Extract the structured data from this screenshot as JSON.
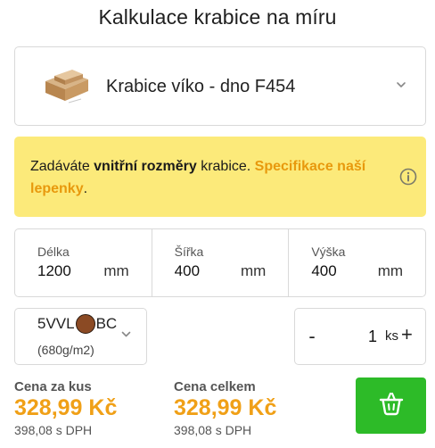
{
  "title": "Kalkulace krabice na míru",
  "product": {
    "name": "Krabice víko - dno F454",
    "thumb_icon": "box-icon"
  },
  "info": {
    "prefix": "Zadáváte ",
    "bold": "vnitřní rozměry",
    "middle": " krabice. ",
    "link": "Specifikace naší lepenky",
    "suffix": ".",
    "icon": "info-icon"
  },
  "dimensions": [
    {
      "label": "Délka",
      "value": "1200",
      "unit": "mm"
    },
    {
      "label": "Šířka",
      "value": "400",
      "unit": "mm"
    },
    {
      "label": "Výška",
      "value": "400",
      "unit": "mm"
    }
  ],
  "material": {
    "code_left": "5VVL",
    "code_right": "BC",
    "weight": "(680g/m2)",
    "swatch_color": "#8b4a24"
  },
  "quantity": {
    "minus": "-",
    "value": "1",
    "unit": "ks",
    "plus": "+"
  },
  "price_per_piece": {
    "label": "Cena za kus",
    "value": "328,99 Kč",
    "with_vat": "398,08 s DPH"
  },
  "price_total": {
    "label": "Cena celkem",
    "value": "328,99 Kč",
    "with_vat": "398,08 s DPH"
  },
  "colors": {
    "accent_orange": "#f0a017",
    "info_bg": "#fcea7a",
    "cart_green": "#2dbb28"
  },
  "cart": {
    "icon": "basket-icon"
  }
}
